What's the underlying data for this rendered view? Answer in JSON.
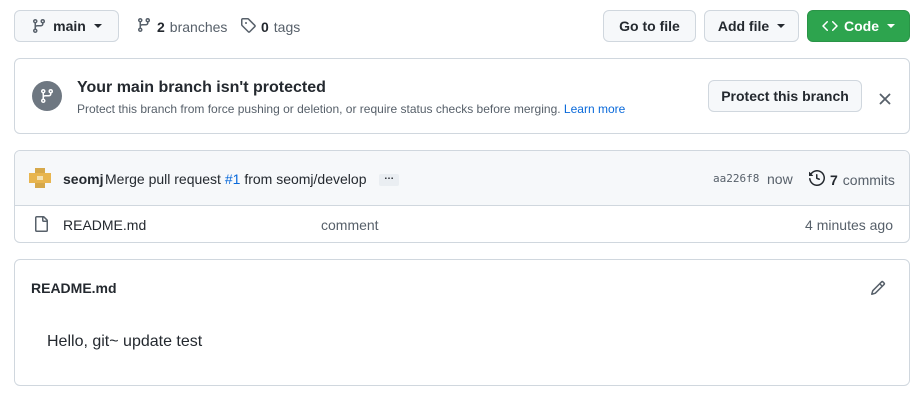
{
  "toolbar": {
    "branch_label": "main",
    "branches_count": "2",
    "branches_label": "branches",
    "tags_count": "0",
    "tags_label": "tags",
    "goto_label": "Go to file",
    "addfile_label": "Add file",
    "code_label": "Code"
  },
  "protect": {
    "title": "Your main branch isn't protected",
    "description": "Protect this branch from force pushing or deletion, or require status checks before merging.",
    "learn_more": "Learn more",
    "button_label": "Protect this branch"
  },
  "commit": {
    "author": "seomj",
    "message_prefix": "Merge pull request",
    "pr_link": "#1",
    "message_suffix": "from seomj/develop",
    "ellipsis": "…",
    "sha": "aa226f8",
    "time": "now",
    "commits_count": "7",
    "commits_label": "commits"
  },
  "files": [
    {
      "name": "README.md",
      "message": "comment",
      "time": "4 minutes ago"
    }
  ],
  "readme": {
    "title": "README.md",
    "content": "Hello, git~ update test"
  },
  "colors": {
    "accent_link": "#0969da",
    "code_button": "#2da44e",
    "border": "#d0d7de"
  },
  "icons": [
    "git-branch-icon",
    "tag-icon",
    "code-icon",
    "shield-branch-icon",
    "close-icon",
    "history-icon",
    "file-icon",
    "pencil-icon"
  ]
}
